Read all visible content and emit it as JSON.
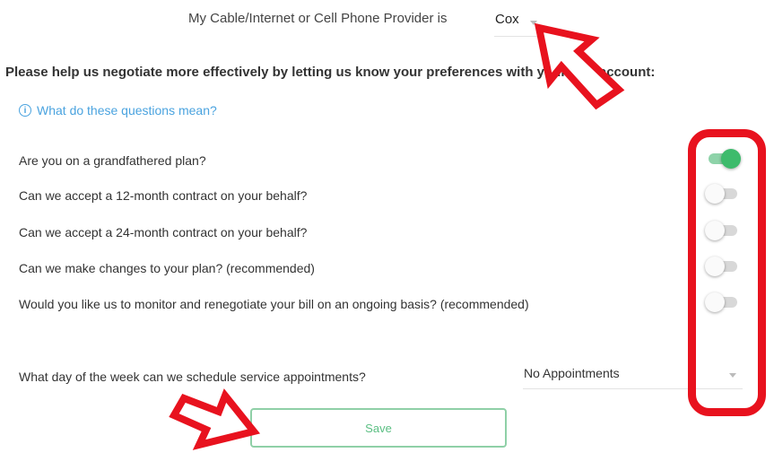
{
  "provider": {
    "label": "My Cable/Internet or Cell Phone Provider is",
    "selected": "Cox"
  },
  "intro_text": "Please help us negotiate more effectively by letting us know your preferences with your Cox account:",
  "help_link": {
    "icon": "info-icon",
    "label": "What do these questions mean?"
  },
  "questions": [
    {
      "label": "Are you on a grandfathered plan?",
      "enabled": true
    },
    {
      "label": "Can we accept a 12-month contract on your behalf?",
      "enabled": false
    },
    {
      "label": "Can we accept a 24-month contract on your behalf?",
      "enabled": false
    },
    {
      "label": "Can we make changes to your plan? (recommended)",
      "enabled": false
    },
    {
      "label": "Would you like us to monitor and renegotiate your bill on an ongoing basis? (recommended)",
      "enabled": false
    }
  ],
  "appointments": {
    "label": "What day of the week can we schedule service appointments?",
    "selected": "No Appointments"
  },
  "save_label": "Save",
  "colors": {
    "accent_green": "#3dbb6c",
    "link_blue": "#4aa3df",
    "annotation_red": "#e8121e"
  }
}
